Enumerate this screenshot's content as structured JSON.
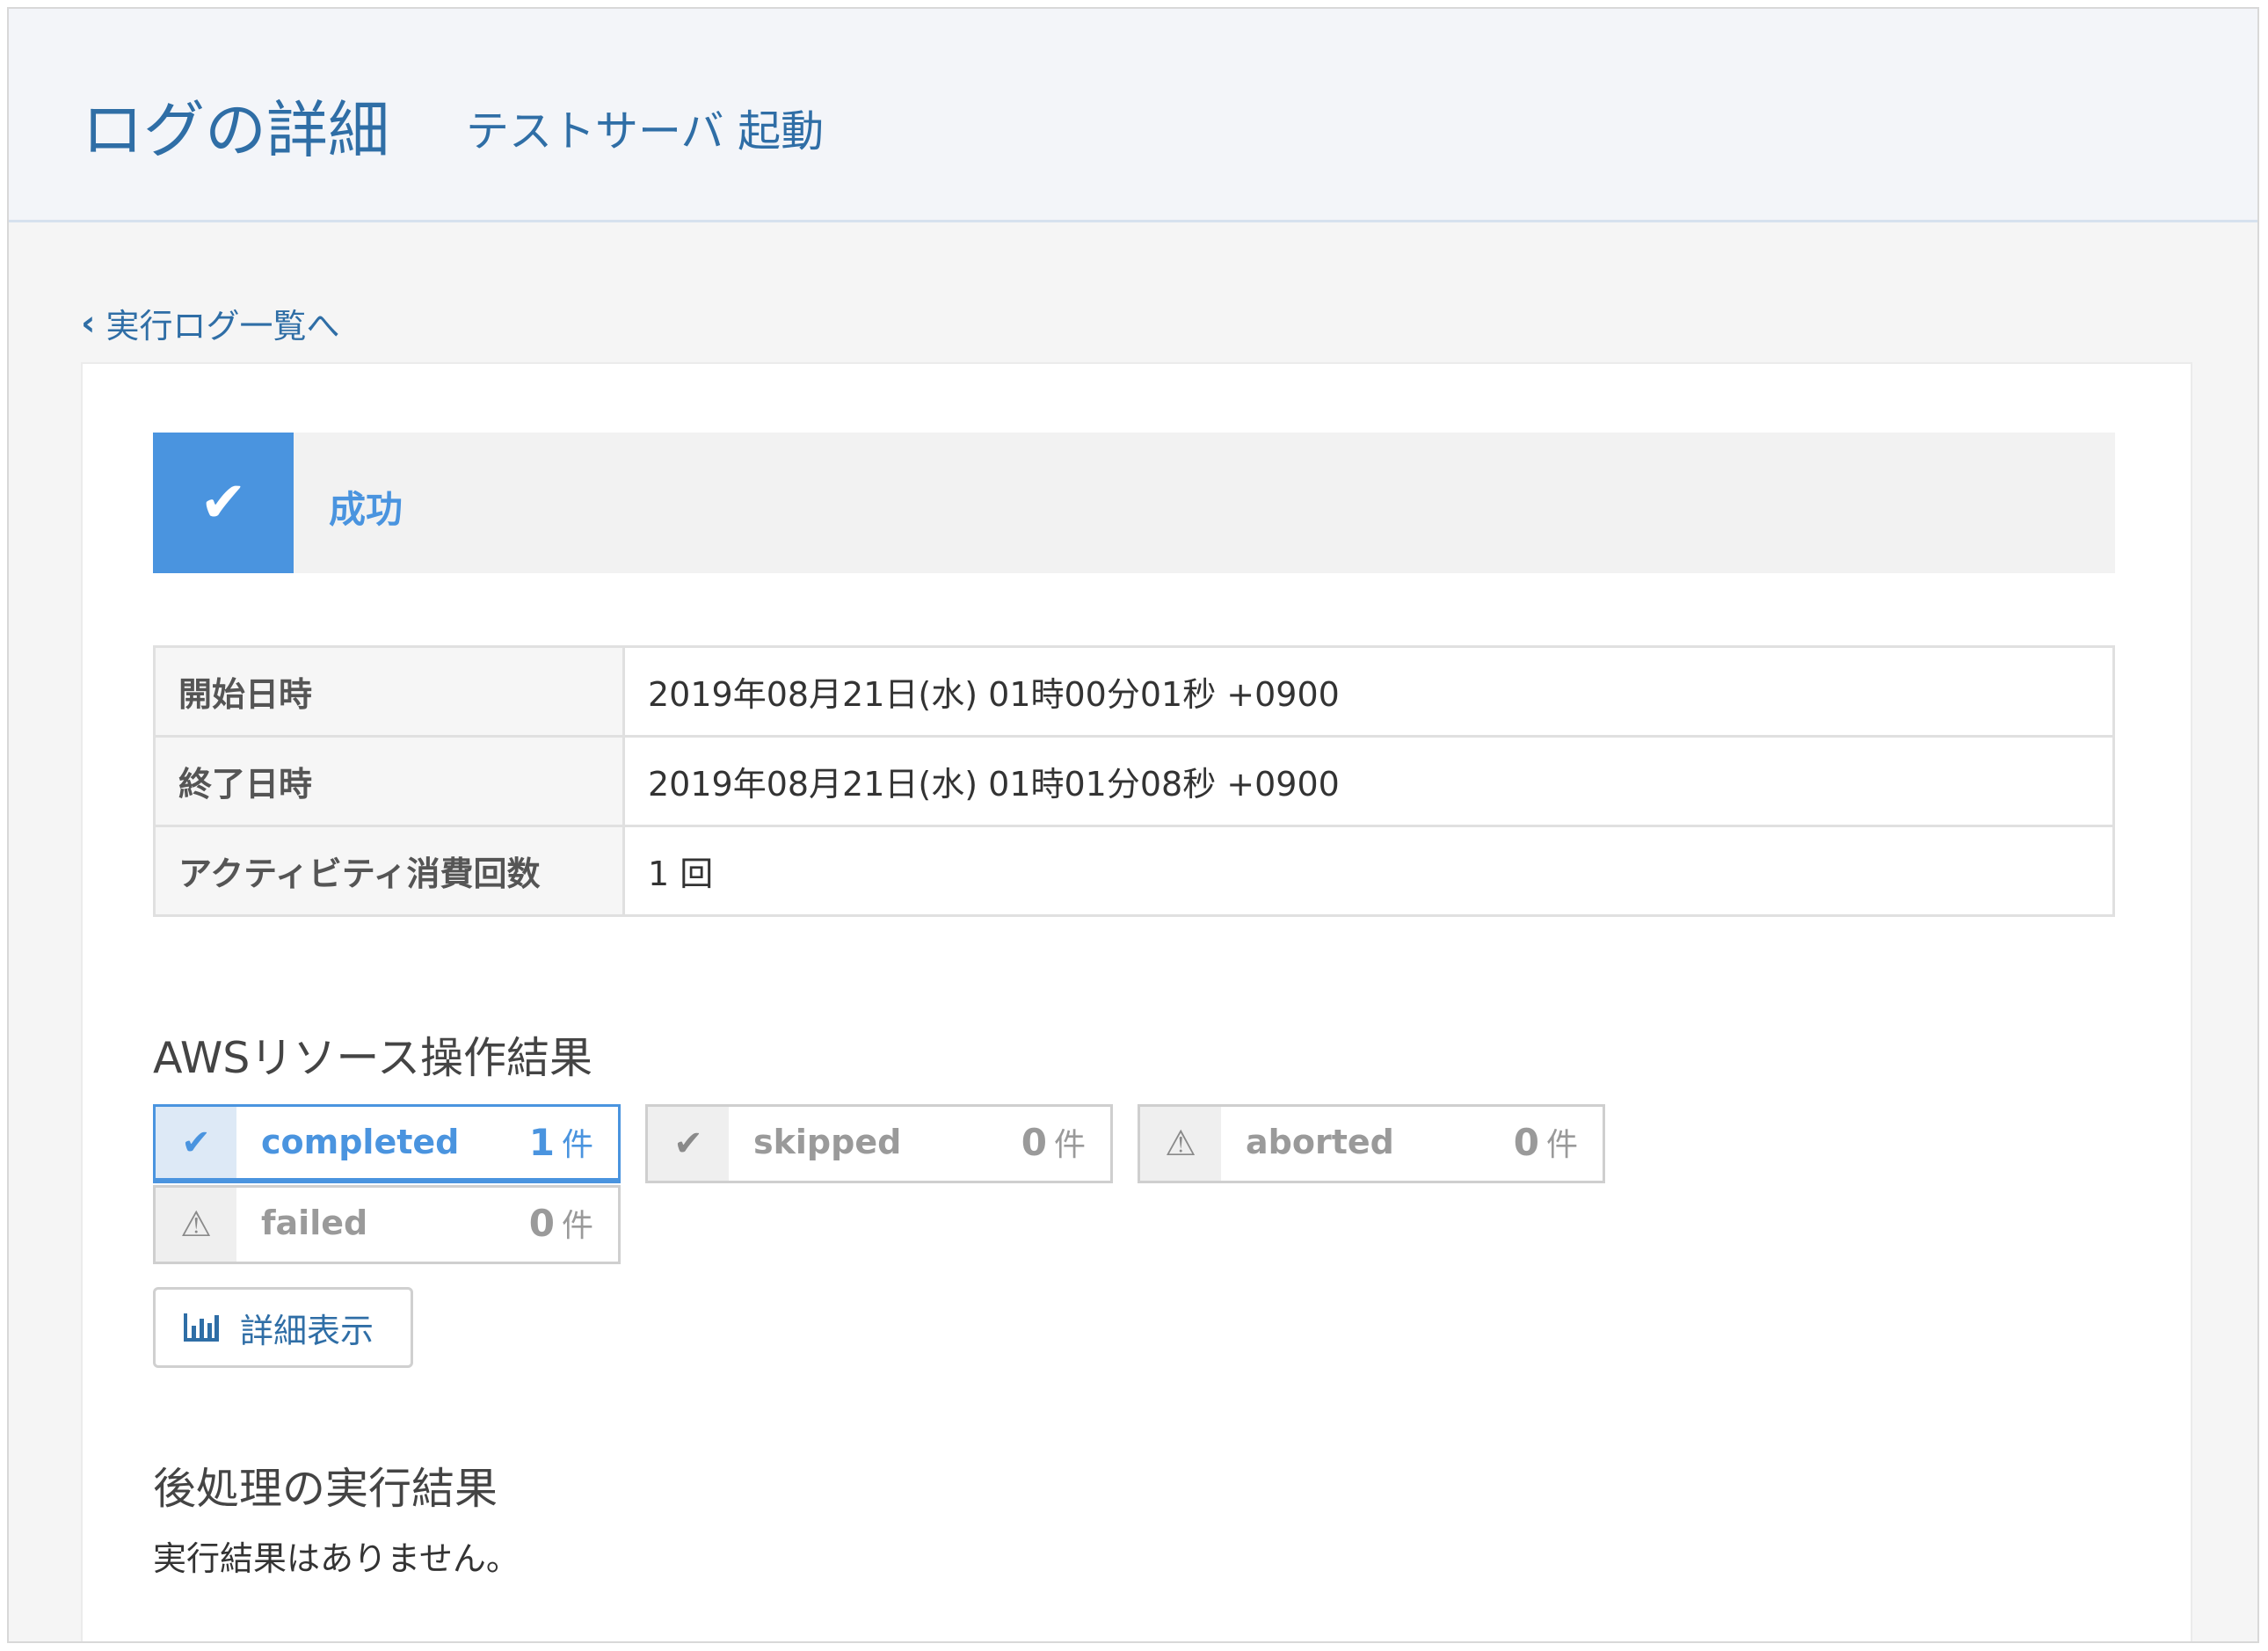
{
  "header": {
    "title": "ログの詳細",
    "subtitle": "テストサーバ 起動"
  },
  "back_link": {
    "label": "実行ログ一覧へ"
  },
  "status": {
    "label": "成功",
    "icon": "check-icon",
    "color": "#4a94df"
  },
  "info": [
    {
      "key": "開始日時",
      "value": "2019年08月21日(水) 01時00分01秒 +0900"
    },
    {
      "key": "終了日時",
      "value": "2019年08月21日(水) 01時01分08秒 +0900"
    },
    {
      "key": "アクティビティ消費回数",
      "value": "1 回"
    }
  ],
  "aws_results": {
    "title": "AWSリソース操作結果",
    "unit": "件",
    "items": [
      {
        "label": "completed",
        "count": "1",
        "icon": "check-icon",
        "active": true
      },
      {
        "label": "skipped",
        "count": "0",
        "icon": "check-icon",
        "active": false
      },
      {
        "label": "aborted",
        "count": "0",
        "icon": "warning-icon",
        "active": false
      },
      {
        "label": "failed",
        "count": "0",
        "icon": "warning-icon",
        "active": false
      }
    ],
    "detail_button": "詳細表示"
  },
  "post_process": {
    "title": "後処理の実行結果",
    "empty_text": "実行結果はありません。"
  }
}
